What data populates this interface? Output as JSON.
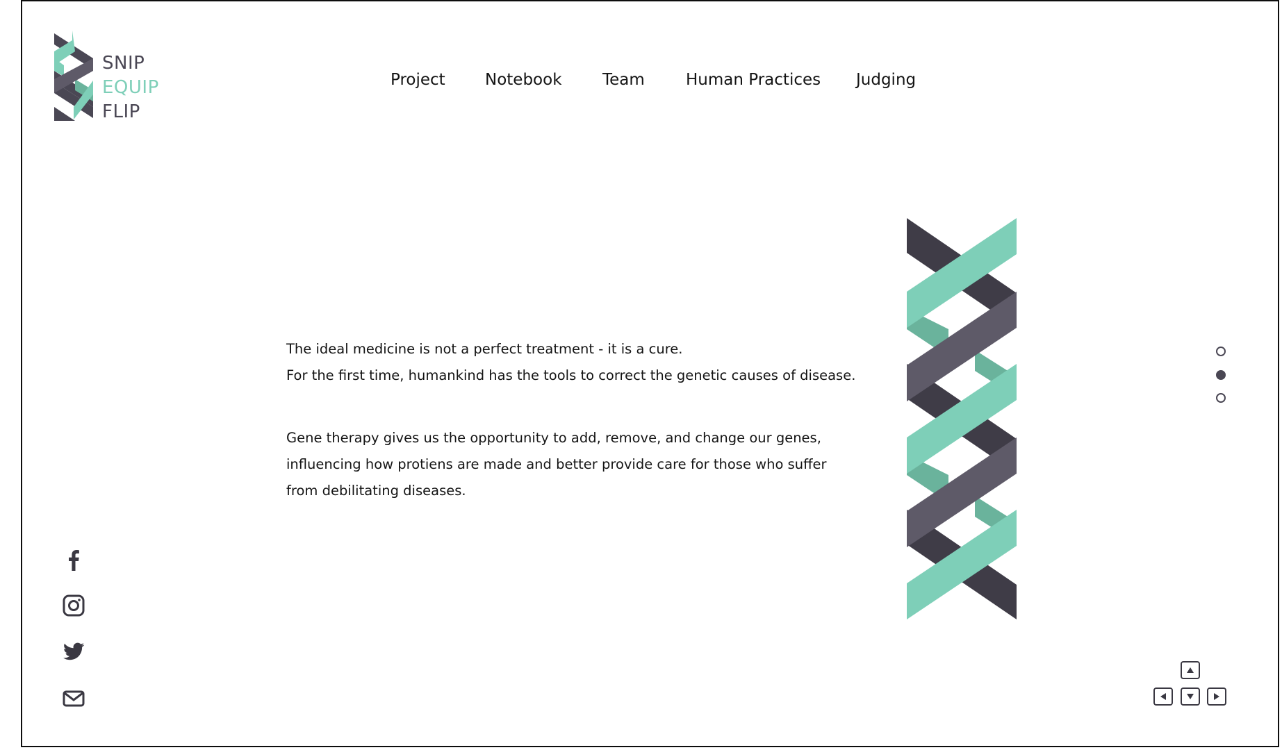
{
  "brand": {
    "logo_lines": [
      "SNIP",
      "EQUIP",
      "FLIP"
    ],
    "colors": {
      "dark": "#4a4754",
      "darker": "#3f3c47",
      "mint": "#7ecfb8",
      "mint_shadow": "#6ab39c",
      "slate": "#5e5a68"
    }
  },
  "nav": {
    "items": [
      {
        "label": "Project"
      },
      {
        "label": "Notebook"
      },
      {
        "label": "Team"
      },
      {
        "label": "Human Practices"
      },
      {
        "label": "Judging"
      }
    ]
  },
  "hero": {
    "paragraph_1": [
      "The ideal medicine is not a perfect treatment - it is a cure.",
      "For the first time, humankind has the tools to correct the genetic causes of disease."
    ],
    "paragraph_2": [
      "Gene therapy gives us the opportunity to add, remove, and change our genes,",
      "influencing how protiens are made and better provide care for those who suffer",
      "from debilitating diseases."
    ]
  },
  "slides": {
    "count": 3,
    "active_index": 1
  },
  "social": [
    {
      "icon": "facebook-icon"
    },
    {
      "icon": "instagram-icon"
    },
    {
      "icon": "twitter-icon"
    },
    {
      "icon": "mail-icon"
    }
  ],
  "keys": [
    {
      "icon": "arrow-up-icon"
    },
    {
      "icon": "arrow-left-icon"
    },
    {
      "icon": "arrow-down-icon"
    },
    {
      "icon": "arrow-right-icon"
    }
  ]
}
